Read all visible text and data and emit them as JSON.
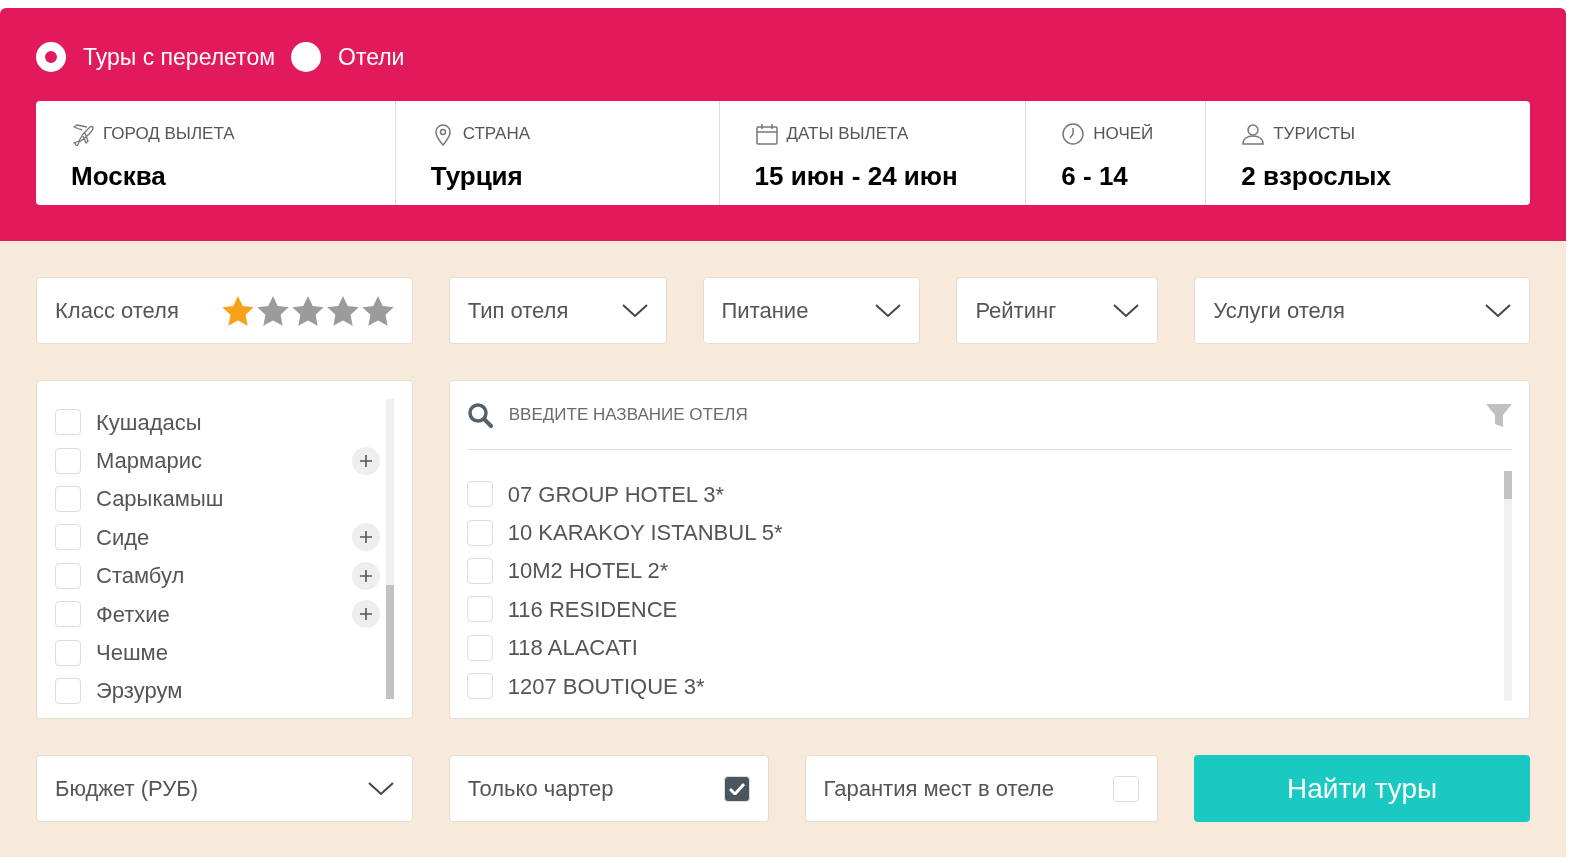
{
  "trip_type": [
    {
      "label": "Туры с перелетом",
      "selected": true
    },
    {
      "label": "Отели",
      "selected": false
    }
  ],
  "search_fields": [
    {
      "kind": "plane",
      "label": "ГОРОД ВЫЛЕТА",
      "value": "Москва"
    },
    {
      "kind": "pin",
      "label": "СТРАНА",
      "value": "Турция"
    },
    {
      "kind": "calendar",
      "label": "ДАТЫ ВЫЛЕТА",
      "value": "15 июн - 24 июн"
    },
    {
      "kind": "clock",
      "label": "НОЧЕЙ",
      "value": "6 - 14"
    },
    {
      "kind": "person",
      "label": "ТУРИСТЫ",
      "value": "2 взрослых"
    }
  ],
  "hotel_class": {
    "label": "Класс отеля",
    "stars": 1
  },
  "filters": [
    "Тип отеля",
    "Питание",
    "Рейтинг",
    "Услуги отеля"
  ],
  "resorts": [
    {
      "name": "Кушадасы",
      "checked": false,
      "expandable": false
    },
    {
      "name": "Мармарис",
      "checked": false,
      "expandable": true
    },
    {
      "name": "Сарыкамыш",
      "checked": false,
      "expandable": false
    },
    {
      "name": "Сиде",
      "checked": false,
      "expandable": true
    },
    {
      "name": "Стамбул",
      "checked": false,
      "expandable": true
    },
    {
      "name": "Фетхие",
      "checked": false,
      "expandable": true
    },
    {
      "name": "Чешме",
      "checked": false,
      "expandable": false
    },
    {
      "name": "Эрзурум",
      "checked": false,
      "expandable": false
    }
  ],
  "hotel_search": {
    "placeholder": "ВВЕДИТЕ НАЗВАНИЕ ОТЕЛЯ"
  },
  "hotels": [
    {
      "name": "07 GROUP HOTEL 3*",
      "checked": false
    },
    {
      "name": "10 KARAKOY ISTANBUL 5*",
      "checked": false
    },
    {
      "name": "10M2 HOTEL 2*",
      "checked": false
    },
    {
      "name": "116 RESIDENCE",
      "checked": false
    },
    {
      "name": "118 ALACATI",
      "checked": false
    },
    {
      "name": "1207 BOUTIQUE 3*",
      "checked": false
    }
  ],
  "budget": {
    "label": "Бюджет (РУБ)"
  },
  "options": [
    {
      "label": "Только чартер",
      "checked": true
    },
    {
      "label": "Гарантия мест в отеле",
      "checked": false
    }
  ],
  "submit": "Найти туры"
}
